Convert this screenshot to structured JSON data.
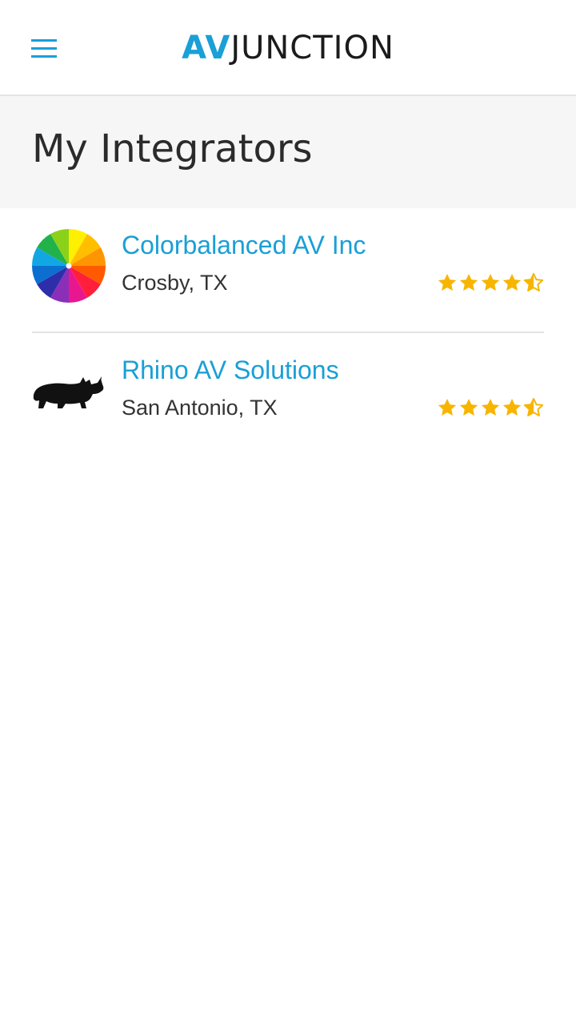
{
  "header": {
    "menu_icon": "hamburger-menu-icon",
    "logo_part1": "AV",
    "logo_part2": "JUNCTION",
    "accent_color": "#1a9fd6"
  },
  "page": {
    "title": "My Integrators"
  },
  "integrators": [
    {
      "name": "Colorbalanced AV Inc",
      "location": "Crosby, TX",
      "rating": 4.5,
      "logo_icon": "color-wheel-icon"
    },
    {
      "name": "Rhino AV Solutions",
      "location": "San Antonio, TX",
      "rating": 4.5,
      "logo_icon": "rhino-icon"
    }
  ],
  "colors": {
    "star": "#f7b500",
    "name_link": "#1a9fd6",
    "title_band_bg": "#f6f6f6"
  }
}
